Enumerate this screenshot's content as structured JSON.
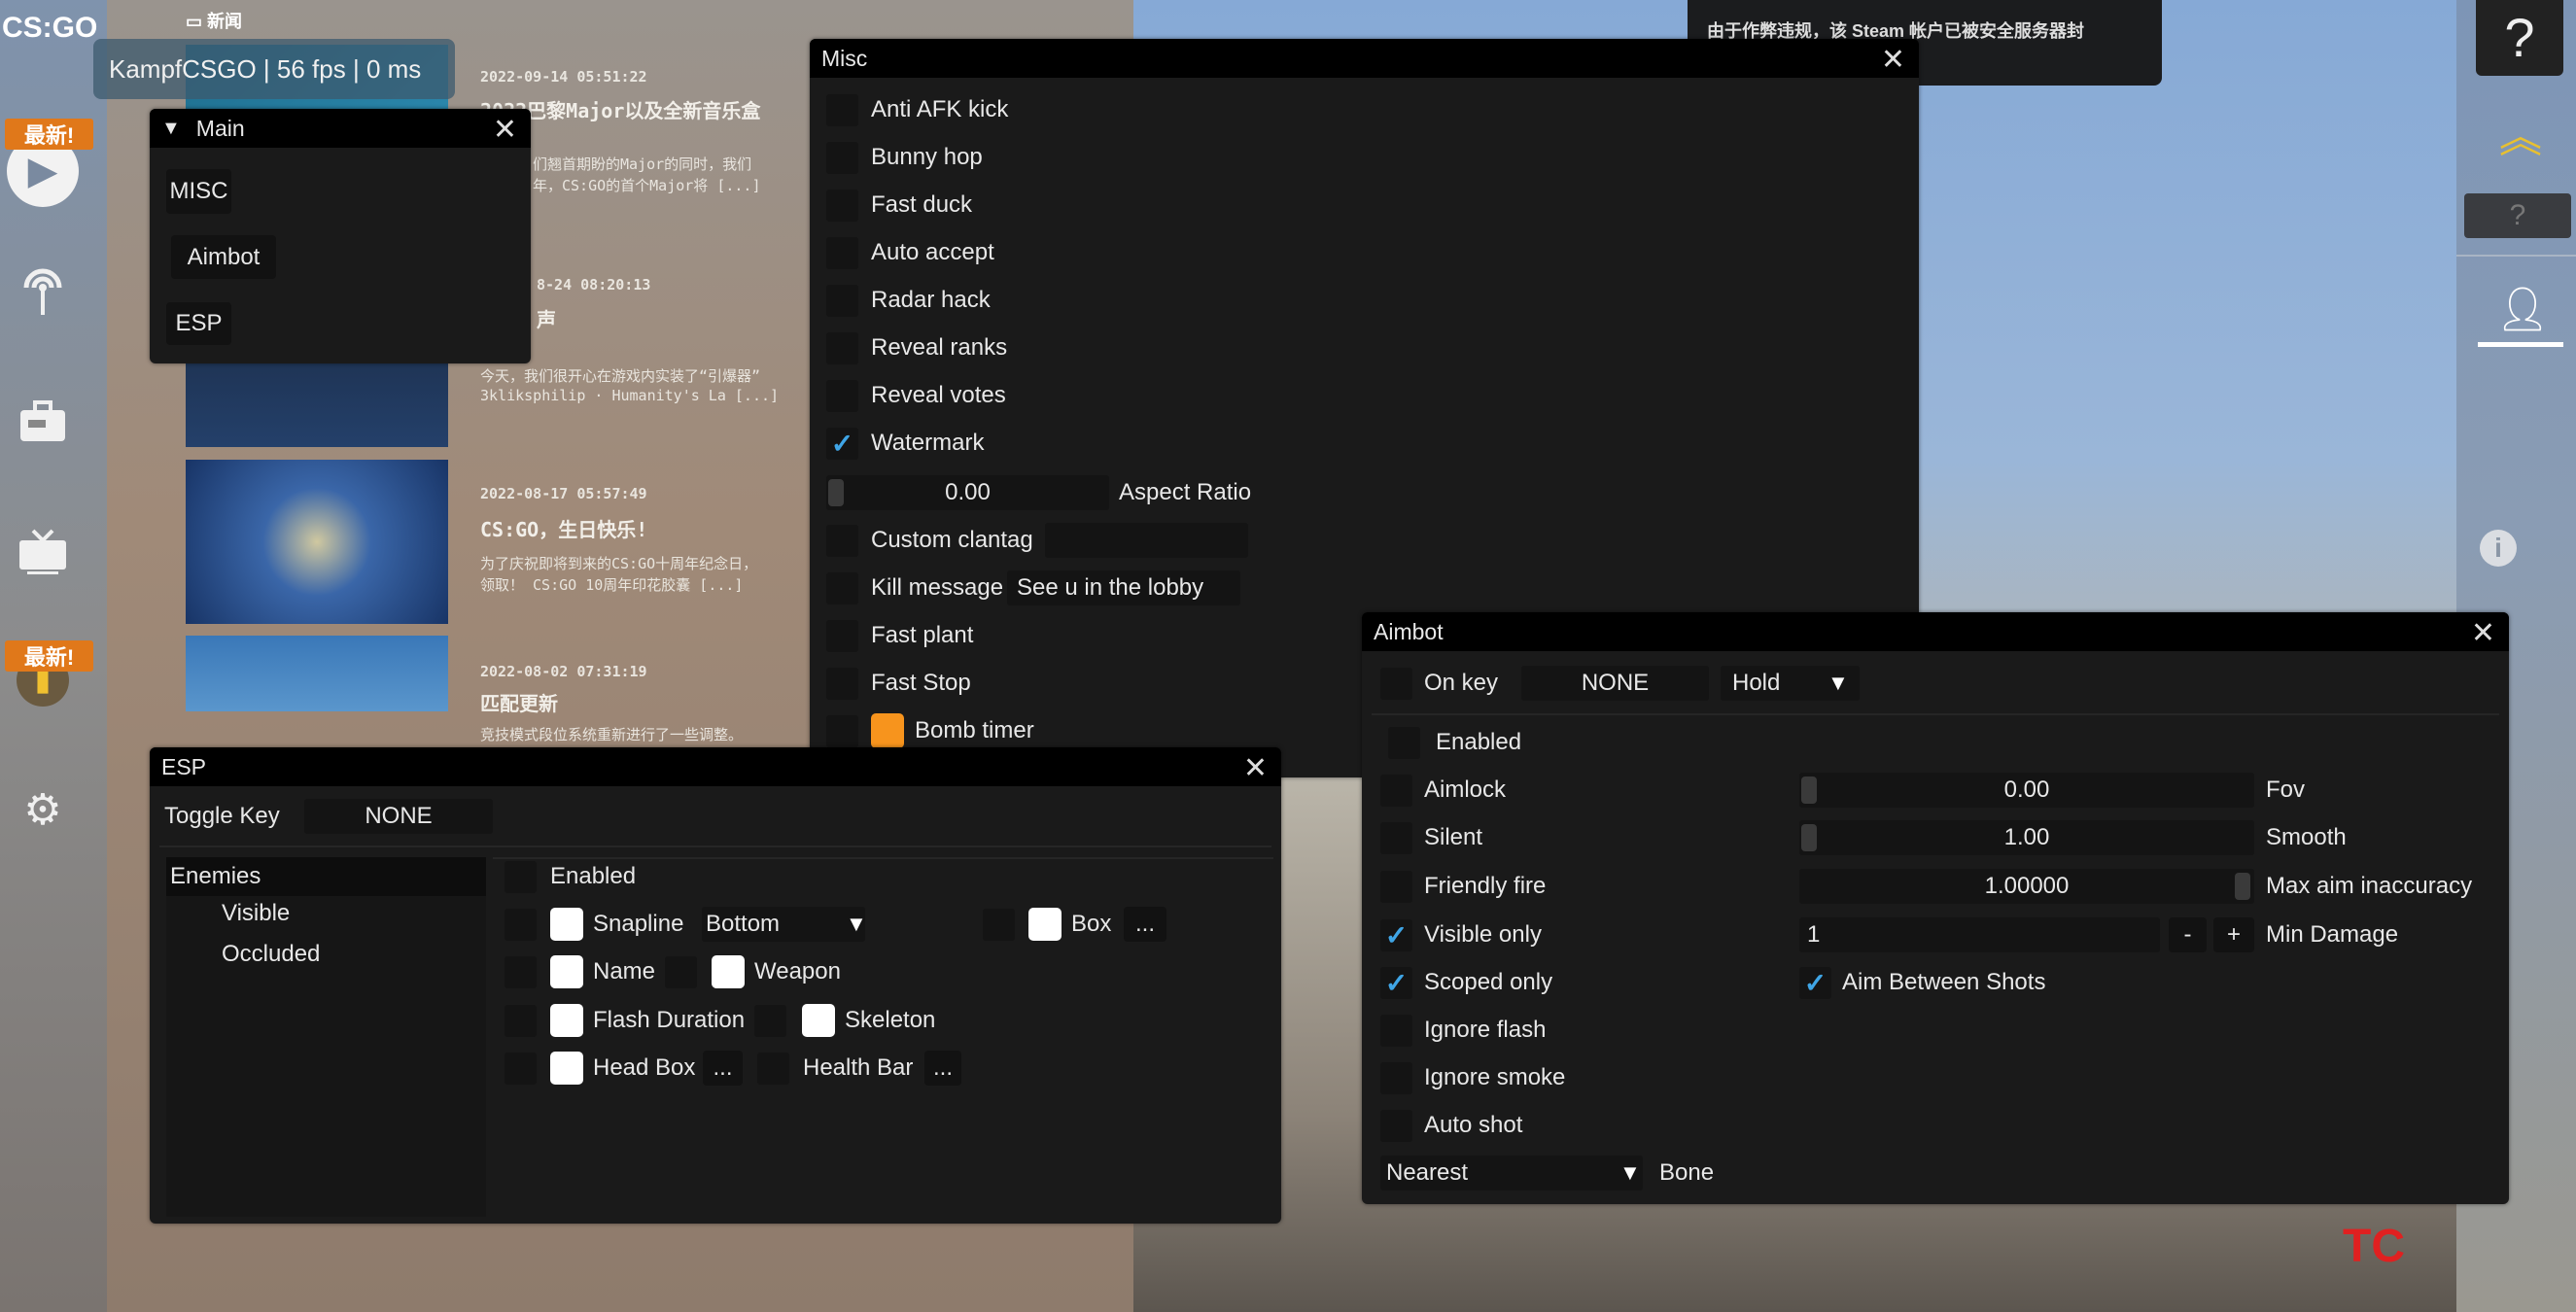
{
  "watermark": "KampfCSGO | 56 fps | 0 ms",
  "sidebar": {
    "logo": "CS:GO",
    "badge": "最新!",
    "icons": [
      "play-icon",
      "broadcast-icon",
      "inventory-icon",
      "tv-icon",
      "stats-icon",
      "gear-icon"
    ]
  },
  "news": {
    "header": "新闻",
    "items": [
      {
        "date": "2022-09-14 05:51:22",
        "title": "2022巴黎Major以及全新音乐盒",
        "desc1": "们翘首期盼的Major的同时，我们",
        "desc2": "年，CS:GO的首个Major将 [...]"
      },
      {
        "date": "8-24 08:20:13",
        "title": "声",
        "desc1": "今天，我们很开心在游戏内实装了“引爆器”",
        "desc2": "3kliksphilip · Humanity's La [...]"
      },
      {
        "date": "2022-08-17 05:57:49",
        "title": "CS:GO，生日快乐!",
        "desc1": "为了庆祝即将到来的CS:GO十周年纪念日，",
        "desc2": "领取！ CS:GO 10周年印花胶囊 [...]"
      },
      {
        "date": "2022-08-02 07:31:19",
        "title": "匹配更新",
        "desc1": "竞技模式段位系统重新进行了一些调整。"
      }
    ]
  },
  "notification": "由于作弊违规，该 Steam 帐户已被安全服务器封",
  "main": {
    "title": "Main",
    "buttons": [
      "MISC",
      "Aimbot",
      "ESP"
    ]
  },
  "misc": {
    "title": "Misc",
    "items": [
      {
        "label": "Anti AFK kick",
        "checked": false
      },
      {
        "label": "Bunny hop",
        "checked": false
      },
      {
        "label": "Fast duck",
        "checked": false
      },
      {
        "label": "Auto accept",
        "checked": false
      },
      {
        "label": "Radar hack",
        "checked": false
      },
      {
        "label": "Reveal ranks",
        "checked": false
      },
      {
        "label": "Reveal votes",
        "checked": false
      },
      {
        "label": "Watermark",
        "checked": true
      }
    ],
    "aspect_ratio": {
      "value": "0.00",
      "label": "Aspect Ratio"
    },
    "custom_clantag": {
      "label": "Custom clantag",
      "value": ""
    },
    "kill_message": {
      "label": "Kill message",
      "value": "See u in the lobby"
    },
    "fast_plant": "Fast plant",
    "fast_stop": "Fast Stop",
    "bomb_timer": {
      "label": "Bomb timer",
      "color": "#f7941d"
    }
  },
  "esp": {
    "title": "ESP",
    "toggle_key": {
      "label": "Toggle Key",
      "value": "NONE"
    },
    "categories": [
      "Enemies",
      "Visible",
      "Occluded"
    ],
    "enabled": "Enabled",
    "snapline": {
      "label": "Snapline",
      "value": "Bottom"
    },
    "box": "Box",
    "name": "Name",
    "weapon": "Weapon",
    "flash": "Flash Duration",
    "skeleton": "Skeleton",
    "head_box": "Head Box",
    "health_bar": "Health Bar",
    "more": "..."
  },
  "aimbot": {
    "title": "Aimbot",
    "on_key": {
      "label": "On key",
      "value": "NONE",
      "mode": "Hold"
    },
    "enabled": "Enabled",
    "checks": [
      {
        "label": "Aimlock",
        "checked": false
      },
      {
        "label": "Silent",
        "checked": false
      },
      {
        "label": "Friendly fire",
        "checked": false
      },
      {
        "label": "Visible only",
        "checked": true
      },
      {
        "label": "Scoped only",
        "checked": true
      },
      {
        "label": "Ignore flash",
        "checked": false
      },
      {
        "label": "Ignore smoke",
        "checked": false
      },
      {
        "label": "Auto shot",
        "checked": false
      }
    ],
    "fov": {
      "value": "0.00",
      "label": "Fov"
    },
    "smooth": {
      "value": "1.00",
      "label": "Smooth"
    },
    "max_aim": {
      "value": "1.00000",
      "label": "Max aim inaccuracy"
    },
    "min_damage": {
      "value": "1",
      "label": "Min Damage",
      "minus": "-",
      "plus": "+"
    },
    "aim_between": {
      "label": "Aim Between Shots",
      "checked": true
    },
    "bone": {
      "value": "Nearest",
      "label": "Bone"
    }
  },
  "colors": {
    "accent_check": "#3fa5e6",
    "window_bg": "#1a1a1a",
    "titlebar": "#000000",
    "badge": "#e0781a"
  }
}
